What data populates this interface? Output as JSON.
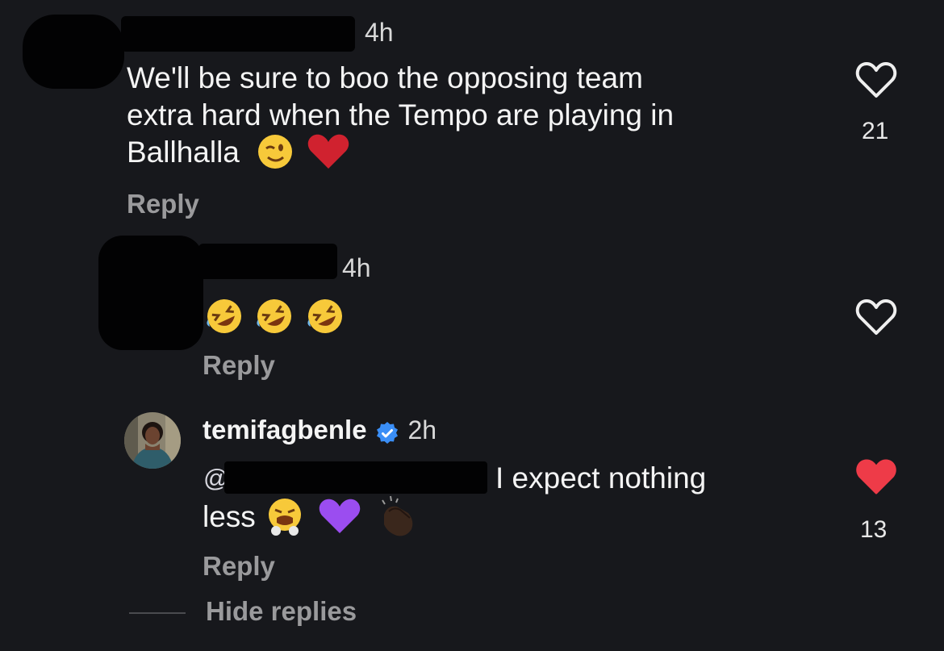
{
  "comments": [
    {
      "time": "4h",
      "text": "We'll be sure to boo the opposing team extra hard when the Tempo are playing in Ballhalla",
      "line1": "We'll be sure to boo the opposing team",
      "line2": "extra hard when the Tempo are playing in",
      "line3": "Ballhalla",
      "emojis": [
        "wink",
        "red-heart"
      ],
      "reply_label": "Reply",
      "like_count": "21",
      "liked": false
    },
    {
      "time": "4h",
      "emojis": [
        "rofl",
        "rofl",
        "rofl"
      ],
      "reply_label": "Reply",
      "like_count": "",
      "liked": false
    },
    {
      "username": "temifagbenle",
      "verified": true,
      "time": "2h",
      "mention_prefix": "@",
      "line1": "I expect nothing",
      "line2": "less",
      "emojis": [
        "steam-nose",
        "purple-heart",
        "clapping-hands-dark"
      ],
      "reply_label": "Reply",
      "like_count": "13",
      "liked": true
    }
  ],
  "hide_replies_label": "Hide replies",
  "colors": {
    "background": "#17181c",
    "liked_heart": "#ee3b48",
    "verified_badge": "#3a8ef6",
    "muted_text": "#9a9a9c"
  }
}
